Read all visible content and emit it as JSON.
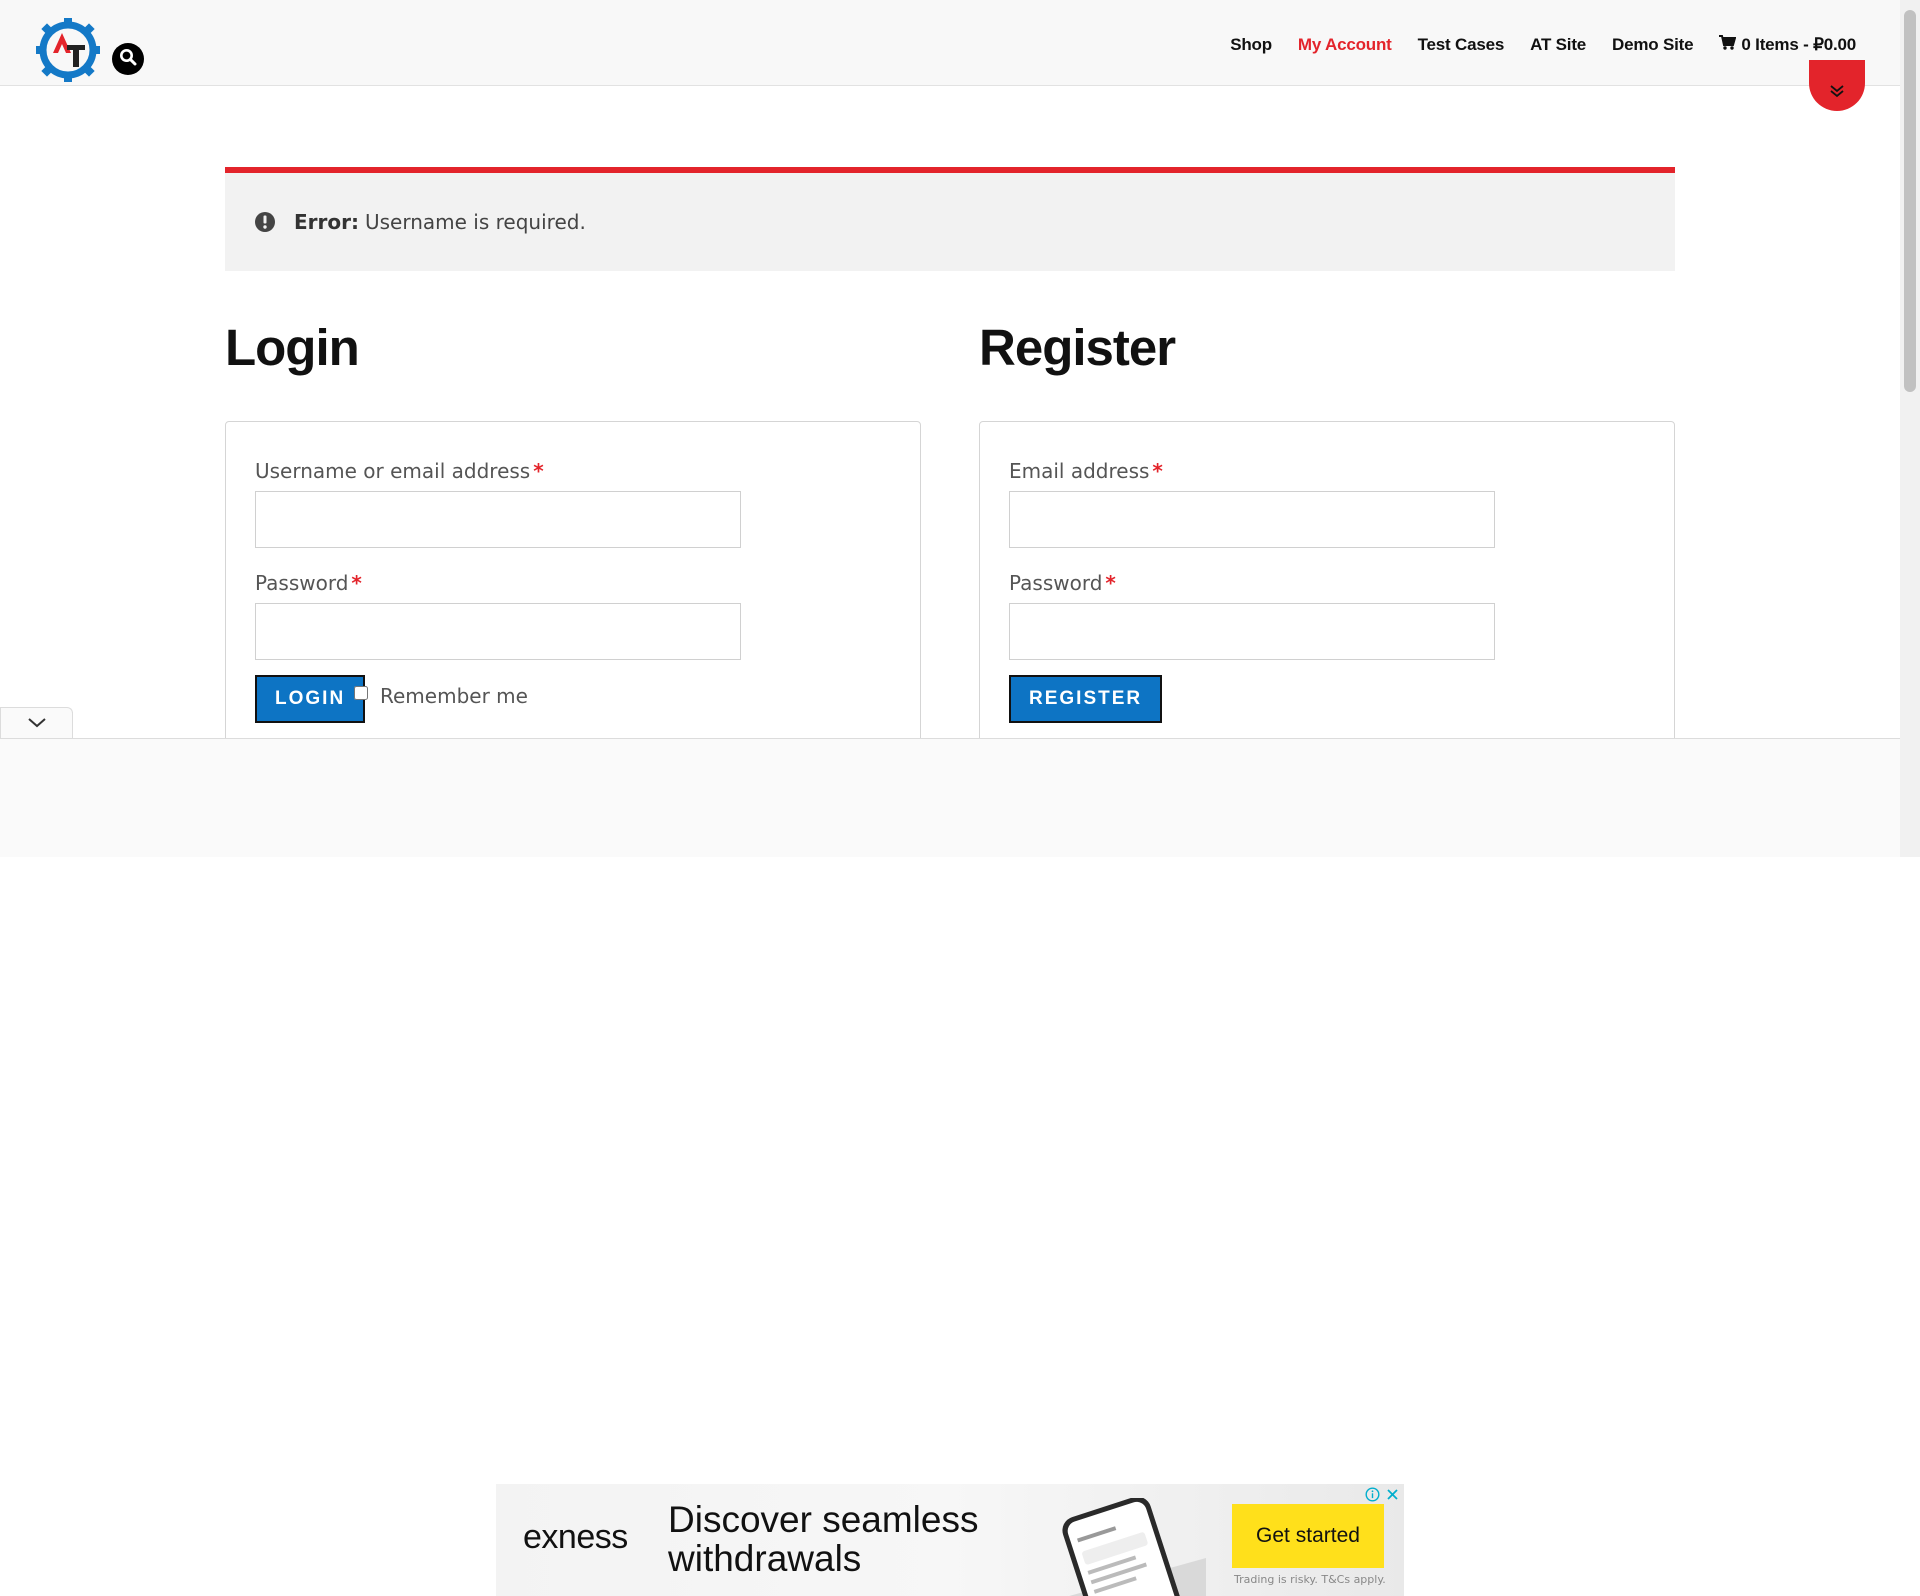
{
  "header": {
    "nav": [
      {
        "label": "Shop",
        "active": false
      },
      {
        "label": "My Account",
        "active": true
      },
      {
        "label": "Test Cases",
        "active": false
      },
      {
        "label": "AT Site",
        "active": false
      },
      {
        "label": "Demo Site",
        "active": false
      }
    ],
    "cart": {
      "label": "0 Items - ₽0.00",
      "icon": "cart-icon"
    },
    "logo_icon": "gear-logo-icon",
    "search_icon": "search-icon"
  },
  "error": {
    "strong": "Error:",
    "message": "Username is required.",
    "icon": "exclamation-circle-icon"
  },
  "login": {
    "title": "Login",
    "username_label": "Username or email address",
    "password_label": "Password",
    "required_mark": "*",
    "button": "Login",
    "remember_label": "Remember me"
  },
  "register": {
    "title": "Register",
    "email_label": "Email address",
    "password_label": "Password",
    "required_mark": "*",
    "button": "Register"
  },
  "ad": {
    "brand": "exness",
    "headline": "Discover seamless withdrawals",
    "cta": "Get started",
    "disclaimer": "Trading is risky. T&Cs apply."
  },
  "colors": {
    "accent_red": "#e3242b",
    "button_blue": "#0d74c4",
    "ad_cta_yellow": "#ffe01b"
  }
}
